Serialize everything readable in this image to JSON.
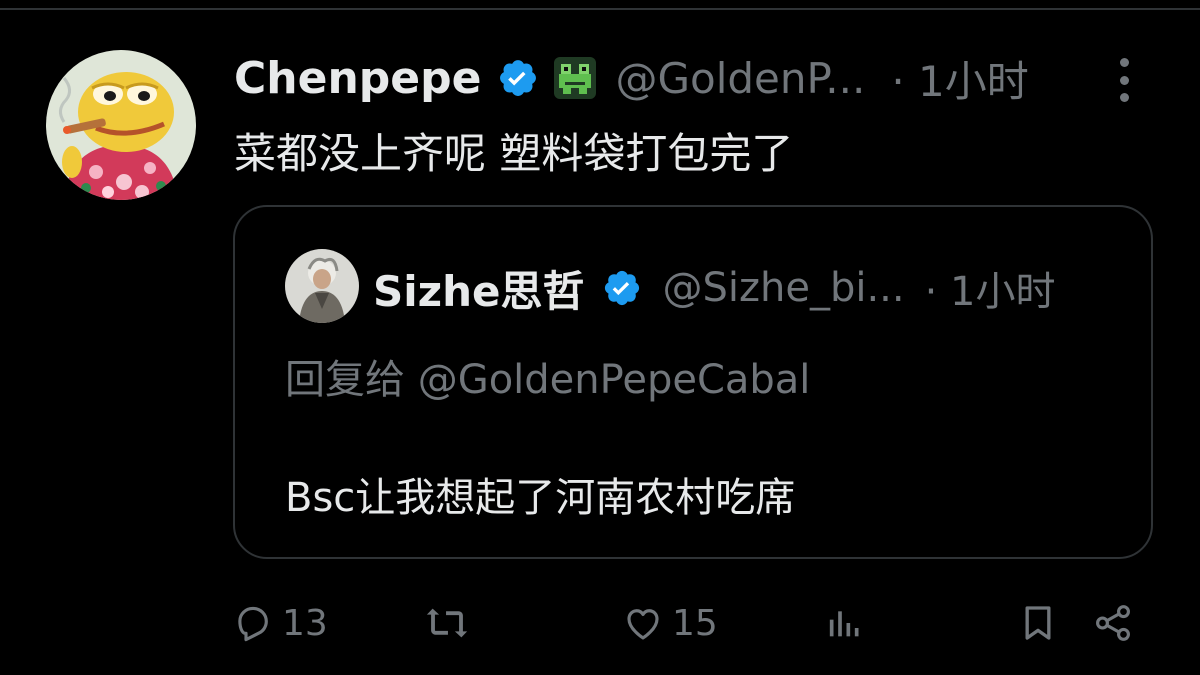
{
  "tweet": {
    "display_name": "Chenpepe",
    "handle": "@GoldenP...",
    "time": "· 1小时",
    "text": "菜都没上齐呢 塑料袋打包完了",
    "badge_emoji": "frog"
  },
  "quoted_tweet": {
    "display_name": "Sizhe思哲",
    "handle": "@Sizhe_bi...",
    "time": "· 1小时",
    "reply_to": "回复给 @GoldenPepeCabal",
    "text": "Bsc让我想起了河南农村吃席"
  },
  "actions": {
    "reply_count": "13",
    "like_count": "15"
  },
  "colors": {
    "background": "#000000",
    "primary_text": "#e7e9ea",
    "secondary_text": "#71767b",
    "verified_blue": "#1d9bf0",
    "border": "#2f3336"
  },
  "icons": [
    "verified-icon",
    "frog-emoji-icon",
    "more-icon",
    "reply-icon",
    "retweet-icon",
    "like-icon",
    "views-icon",
    "bookmark-icon",
    "share-icon"
  ]
}
